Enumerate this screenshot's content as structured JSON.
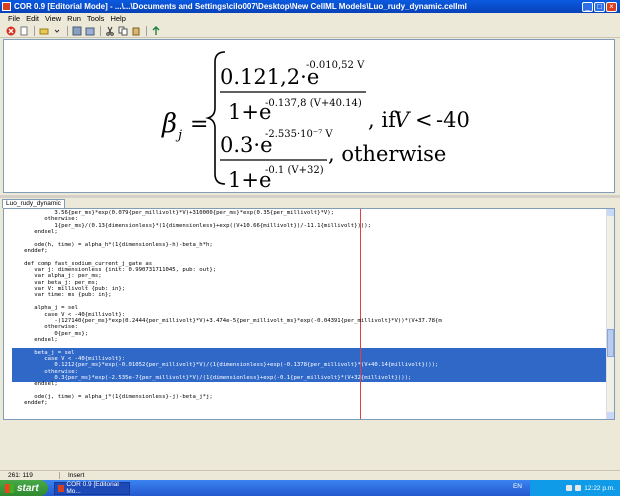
{
  "window": {
    "title": "COR 0.9 [Editorial Mode] - ...\\...\\Documents and Settings\\cilo007\\Desktop\\New CellML Models\\Luo_rudy_dynamic.cellml"
  },
  "menu": [
    "File",
    "Edit",
    "View",
    "Run",
    "Tools",
    "Help"
  ],
  "toolbar_icons": [
    "stop-icon",
    "new-file-icon",
    "open-folder-icon",
    "save-icon",
    "save-all-icon",
    "cut-icon",
    "copy-icon",
    "paste-icon",
    "run-icon"
  ],
  "math": {
    "lhs": "β",
    "lhs_sub": "j",
    "case1": {
      "num_coef": "0.121,2·e",
      "num_exp": "-0.010,52 V",
      "den_base": "1+e",
      "den_exp": "-0.137,8 (V+40.14)",
      "condition_text": ", if",
      "condition_var": "V",
      "condition_op": "<",
      "condition_val": "-40"
    },
    "case2": {
      "num_coef": "0.3·e",
      "num_exp": "-2.535·10⁻⁷ V",
      "den_base": "1+e",
      "den_exp": "-0.1 (V+32)",
      "condition_text": ", otherwise"
    }
  },
  "document_tab": "Luo_rudy_dynamic",
  "code_lines": [
    "            3.56{per_ms}*exp(0.079{per_millivolt}*V)+310000{per_ms}*exp(0.35{per_millivolt}*V);",
    "         otherwise:",
    "            1{per_ms}/(0.13{dimensionless}*(1{dimensionless}+exp((V+10.66{millivolt})/-11.1{millivolt})));",
    "      endsel;",
    "",
    "      ode(h, time) = alpha_h*(1{dimensionless}-h)-beta_h*h;",
    "   enddef;",
    "",
    "   def comp fast_sodium_current_j_gate as",
    "      var j: dimensionless {init: 0.990731711045, pub: out};",
    "      var alpha_j: per_ms;",
    "      var beta_j: per_ms;",
    "      var V: millivolt {pub: in};",
    "      var time: ms {pub: in};",
    "",
    "      alpha_j = sel",
    "         case V < -40{millivolt}:",
    "            -(127140{per_ms}*exp(0.2444{per_millivolt}*V)+3.474e-5{per_millivolt_ms}*exp(-0.04391{per_millivolt}*V))*(V+37.78{m",
    "         otherwise:",
    "            0{per_ms};",
    "      endsel;",
    "",
    "      beta_j = sel",
    "         case V < -40{millivolt}:",
    "            0.1212{per_ms}*exp(-0.01052{per_millivolt}*V)/(1{dimensionless}+exp(-0.1378{per_millivolt}*(V+40.14{millivolt})));",
    "         otherwise:",
    "            0.3{per_ms}*exp(-2.535e-7{per_millivolt}*V)/(1{dimensionless}+exp(-0.1{per_millivolt}*(V+32{millivolt})));",
    "      endsel;",
    "",
    "      ode(j, time) = alpha_j*(1{dimensionless}-j)-beta_j*j;",
    "   enddef;"
  ],
  "selected_lines": [
    22,
    23,
    24,
    25,
    26
  ],
  "status": {
    "position": "261: 119",
    "mode": "Insert"
  },
  "taskbar": {
    "start_label": "start",
    "task_label": "COR 0.9 [Editorial Mo...",
    "language": "EN",
    "clock": "12:22 p.m."
  }
}
